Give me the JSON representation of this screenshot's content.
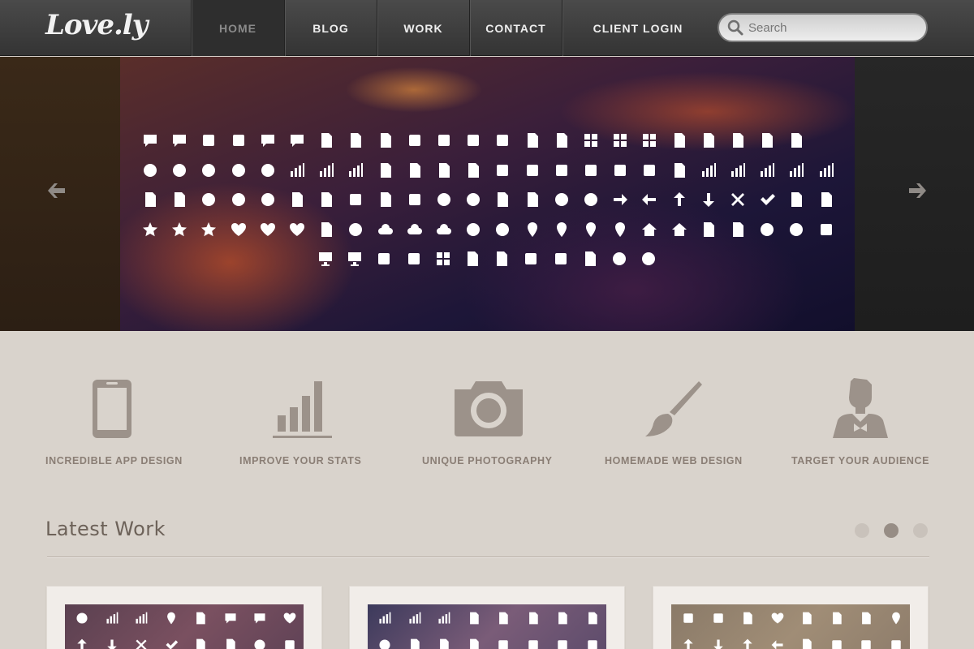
{
  "header": {
    "logo": "Love.ly",
    "nav": [
      {
        "label": "HOME",
        "active": true
      },
      {
        "label": "BLOG",
        "active": false
      },
      {
        "label": "WORK",
        "active": false
      },
      {
        "label": "CONTACT",
        "active": false
      },
      {
        "label": "CLIENT LOGIN",
        "active": false
      }
    ],
    "search": {
      "placeholder": "Search",
      "value": ""
    }
  },
  "hero": {
    "prev_icon": "arrow-left-icon",
    "next_icon": "arrow-right-icon"
  },
  "features": [
    {
      "label": "INCREDIBLE APP DESIGN",
      "icon": "tablet-icon"
    },
    {
      "label": "IMPROVE YOUR STATS",
      "icon": "bar-chart-icon"
    },
    {
      "label": "UNIQUE PHOTOGRAPHY",
      "icon": "camera-icon"
    },
    {
      "label": "HOMEMADE WEB DESIGN",
      "icon": "brush-icon"
    },
    {
      "label": "TARGET YOUR AUDIENCE",
      "icon": "person-icon"
    }
  ],
  "latest_work": {
    "title": "Latest Work",
    "pager": {
      "pages": 3,
      "current": 2
    }
  },
  "colors": {
    "nav_bg": "#3e3e3e",
    "page_bg": "#d9d3cc",
    "feature_gray": "#9c928a",
    "label_color": "#8a7e75"
  }
}
